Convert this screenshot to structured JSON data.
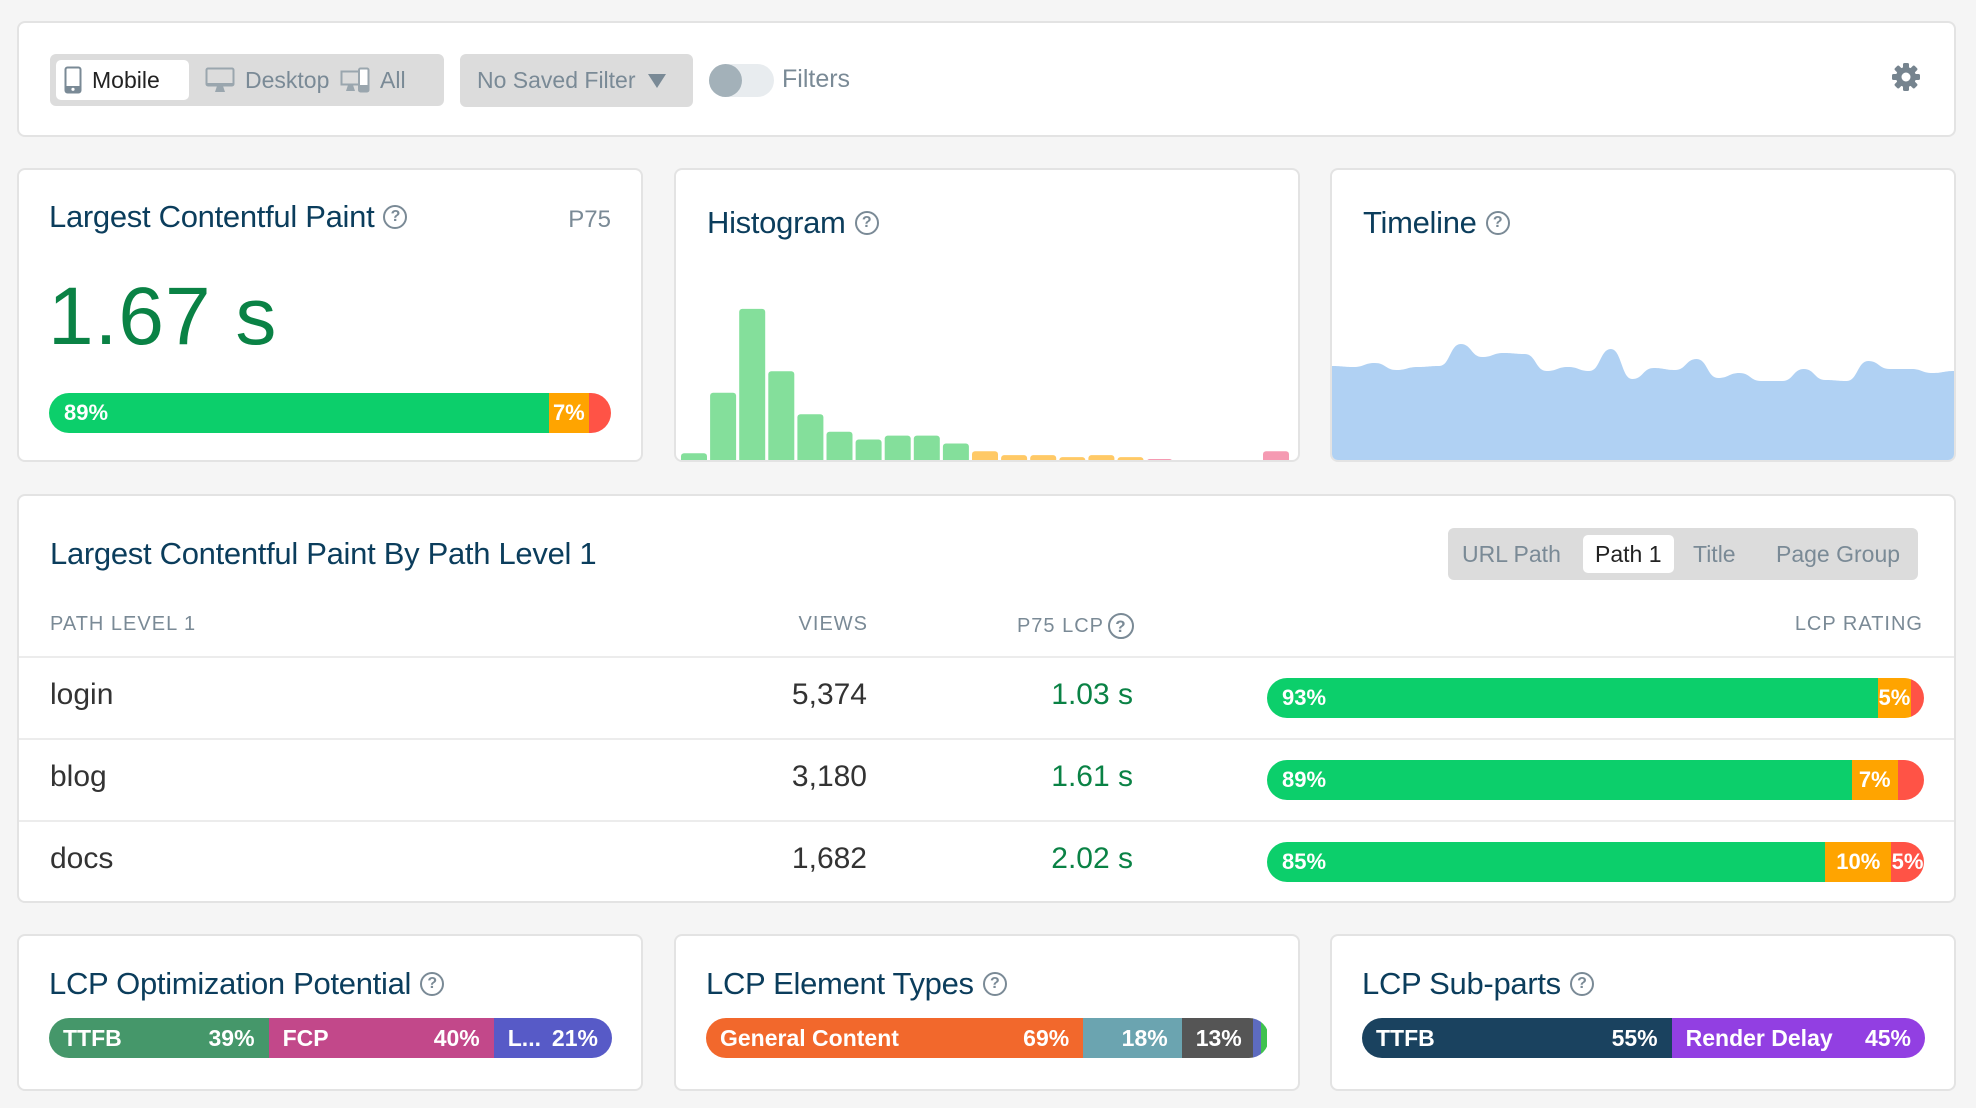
{
  "toolbar": {
    "devices": [
      {
        "label": "Mobile",
        "icon": "mobile-icon",
        "active": true
      },
      {
        "label": "Desktop",
        "icon": "desktop-icon",
        "active": false
      },
      {
        "label": "All",
        "icon": "all-devices-icon",
        "active": false
      }
    ],
    "saved_filter": "No Saved Filter",
    "filters_label": "Filters",
    "filters_enabled": false,
    "settings_icon": "gear-icon"
  },
  "lcp_card": {
    "title": "Largest Contentful Paint",
    "percentile": "P75",
    "value": "1.67 s",
    "rating": [
      {
        "label": "89%",
        "pct": 89,
        "class": "good"
      },
      {
        "label": "7%",
        "pct": 7,
        "class": "ni"
      },
      {
        "label": "",
        "pct": 4,
        "class": "poor"
      }
    ]
  },
  "histogram": {
    "title": "Histogram",
    "chart_data": {
      "type": "bar",
      "title": "Histogram",
      "values": [
        8,
        70,
        156,
        92,
        48,
        30,
        22,
        26,
        26,
        18,
        10,
        6,
        6,
        4,
        6,
        4,
        2,
        0,
        0,
        0,
        10
      ],
      "ratings": [
        "good",
        "good",
        "good",
        "good",
        "good",
        "good",
        "good",
        "good",
        "good",
        "good",
        "ni",
        "ni",
        "ni",
        "ni",
        "ni",
        "ni",
        "poor",
        "poor",
        "poor",
        "poor",
        "poor"
      ],
      "colors": {
        "good": "#84df9b",
        "ni": "#ffc966",
        "poor": "#f59ab2"
      },
      "ylim": [
        0,
        160
      ]
    }
  },
  "timeline": {
    "title": "Timeline",
    "chart_data": {
      "type": "area",
      "title": "Timeline",
      "values": [
        94,
        93,
        97,
        90,
        93,
        94,
        116,
        103,
        107,
        106,
        89,
        93,
        89,
        111,
        81,
        92,
        90,
        101,
        82,
        87,
        79,
        79,
        91,
        80,
        79,
        99,
        91,
        91,
        87,
        89
      ],
      "color": "#b0d1f3",
      "ylim": [
        0,
        140
      ]
    }
  },
  "table": {
    "title": "Largest Contentful Paint By Path Level 1",
    "groupings": [
      {
        "label": "URL Path",
        "active": false
      },
      {
        "label": "Path 1",
        "active": true
      },
      {
        "label": "Title",
        "active": false
      },
      {
        "label": "Page Group",
        "active": false
      }
    ],
    "headers": {
      "path": "PATH LEVEL 1",
      "views": "VIEWS",
      "p75": "P75 LCP",
      "rating": "LCP RATING"
    },
    "rows": [
      {
        "path": "login",
        "views": "5,374",
        "p75": "1.03 s",
        "rating": [
          {
            "label": "93%",
            "pct": 93,
            "class": "good"
          },
          {
            "label": "5%",
            "pct": 5,
            "class": "ni"
          },
          {
            "label": "",
            "pct": 2,
            "class": "poor"
          }
        ]
      },
      {
        "path": "blog",
        "views": "3,180",
        "p75": "1.61 s",
        "rating": [
          {
            "label": "89%",
            "pct": 89,
            "class": "good"
          },
          {
            "label": "7%",
            "pct": 7,
            "class": "ni"
          },
          {
            "label": "",
            "pct": 4,
            "class": "poor"
          }
        ]
      },
      {
        "path": "docs",
        "views": "1,682",
        "p75": "2.02 s",
        "rating": [
          {
            "label": "85%",
            "pct": 85,
            "class": "good"
          },
          {
            "label": "10%",
            "pct": 10,
            "class": "ni"
          },
          {
            "label": "5%",
            "pct": 5,
            "class": "poor"
          }
        ]
      }
    ]
  },
  "optimization": {
    "title": "LCP Optimization Potential",
    "parts": [
      {
        "name": "TTFB",
        "pct_label": "39%",
        "pct": 39,
        "color": "#45976a"
      },
      {
        "name": "FCP",
        "pct_label": "40%",
        "pct": 40,
        "color": "#c2488a"
      },
      {
        "name": "L...",
        "pct_label": "21%",
        "pct": 21,
        "color": "#575ac7"
      }
    ]
  },
  "element_types": {
    "title": "LCP Element Types",
    "parts": [
      {
        "name": "General Content",
        "pct_label": "69%",
        "pct": 67,
        "color": "#f2682c"
      },
      {
        "name": "",
        "pct_label": "18%",
        "pct": 17.5,
        "color": "#6ba4b0"
      },
      {
        "name": "",
        "pct_label": "13%",
        "pct": 12.7,
        "color": "#555555"
      },
      {
        "name": "",
        "pct_label": "",
        "pct": 1.3,
        "color": "#5d6bbf"
      },
      {
        "name": "",
        "pct_label": "",
        "pct": 1.2,
        "color": "#3fc24e"
      }
    ]
  },
  "subparts": {
    "title": "LCP Sub-parts",
    "parts": [
      {
        "name": "TTFB",
        "pct_label": "55%",
        "pct": 55,
        "color": "#1a425f"
      },
      {
        "name": "Render Delay",
        "pct_label": "45%",
        "pct": 45,
        "color": "#923fe2"
      }
    ]
  }
}
